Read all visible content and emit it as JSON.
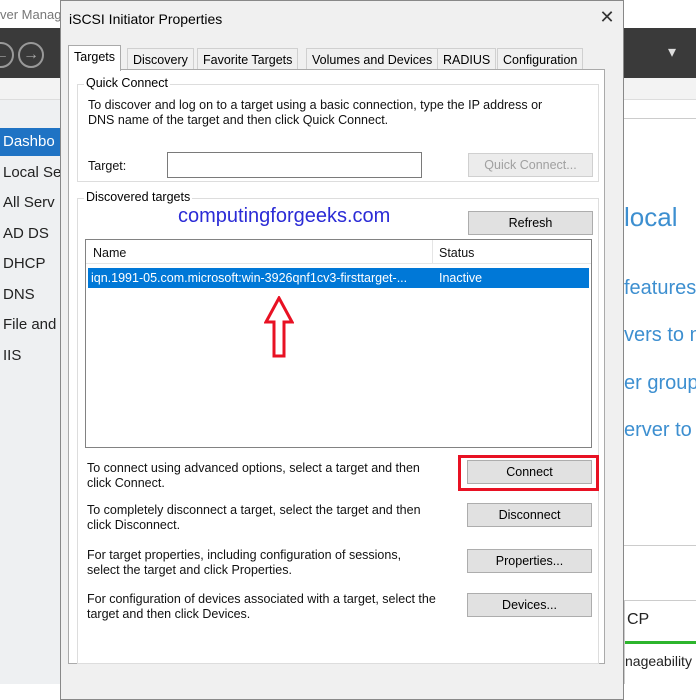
{
  "background_app": {
    "title": "ver Manag",
    "nav": [
      "Dashbo",
      "Local Se",
      "All Serv",
      "AD DS",
      "DHCP",
      "DNS",
      "File and",
      "IIS"
    ],
    "right_texts": [
      "local",
      "features",
      "vers to m",
      "er group",
      "erver to",
      "CP",
      "nageability"
    ]
  },
  "dialog": {
    "title": "iSCSI Initiator Properties",
    "tabs": [
      "Targets",
      "Discovery",
      "Favorite Targets",
      "Volumes and Devices",
      "RADIUS",
      "Configuration"
    ],
    "quick_connect": {
      "label": "Quick Connect",
      "description": "To discover and log on to a target using a basic connection, type the IP address or DNS name of the target and then click Quick Connect.",
      "target_label": "Target:",
      "target_value": "",
      "button": "Quick Connect..."
    },
    "discovered": {
      "label": "Discovered targets",
      "refresh": "Refresh",
      "columns": [
        "Name",
        "Status"
      ],
      "rows": [
        {
          "name": "iqn.1991-05.com.microsoft:win-3926qnf1cv3-firsttarget-...",
          "status": "Inactive"
        }
      ]
    },
    "actions": [
      {
        "text": "To connect using advanced options, select a target and then click Connect.",
        "button": "Connect"
      },
      {
        "text": "To completely disconnect a target, select the target and then click Disconnect.",
        "button": "Disconnect"
      },
      {
        "text": "For target properties, including configuration of sessions, select the target and click Properties.",
        "button": "Properties..."
      },
      {
        "text": "For configuration of devices associated with a target, select the target and then click Devices.",
        "button": "Devices..."
      }
    ]
  },
  "watermark": "computingforgeeks.com",
  "colors": {
    "selection": "#0078d7",
    "highlight": "#e81123",
    "accent": "#3d8fd0"
  }
}
